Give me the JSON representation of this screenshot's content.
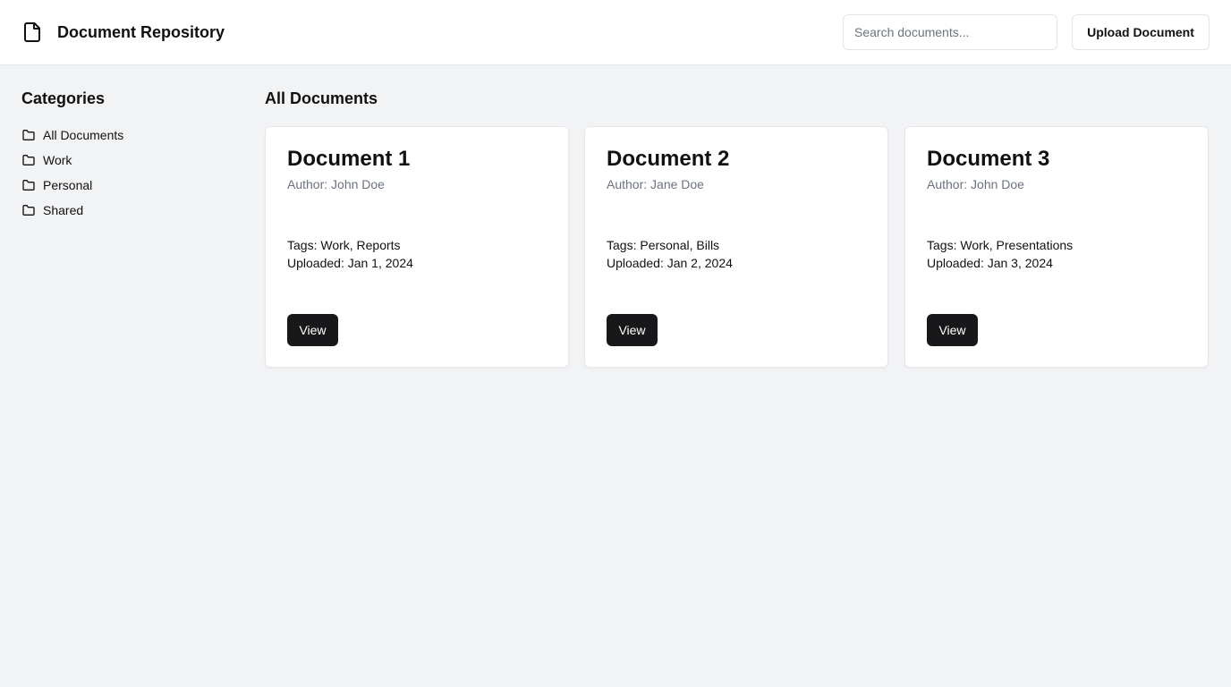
{
  "header": {
    "title": "Document Repository",
    "icon": "file-icon",
    "search_placeholder": "Search documents...",
    "search_value": "",
    "upload_label": "Upload Document"
  },
  "sidebar": {
    "title": "Categories",
    "items": [
      {
        "label": "All Documents",
        "icon": "folder-icon"
      },
      {
        "label": "Work",
        "icon": "folder-icon"
      },
      {
        "label": "Personal",
        "icon": "folder-icon"
      },
      {
        "label": "Shared",
        "icon": "folder-icon"
      }
    ]
  },
  "main": {
    "title": "All Documents",
    "documents": [
      {
        "title": "Document 1",
        "author": "Author: John Doe",
        "tags": "Tags: Work, Reports",
        "uploaded": "Uploaded: Jan 1, 2024",
        "view_label": "View"
      },
      {
        "title": "Document 2",
        "author": "Author: Jane Doe",
        "tags": "Tags: Personal, Bills",
        "uploaded": "Uploaded: Jan 2, 2024",
        "view_label": "View"
      },
      {
        "title": "Document 3",
        "author": "Author: John Doe",
        "tags": "Tags: Work, Presentations",
        "uploaded": "Uploaded: Jan 3, 2024",
        "view_label": "View"
      }
    ]
  },
  "colors": {
    "background": "#f2f3f5",
    "surface": "#ffffff",
    "primary_button": "#18181b",
    "muted_text": "#6b7280"
  }
}
